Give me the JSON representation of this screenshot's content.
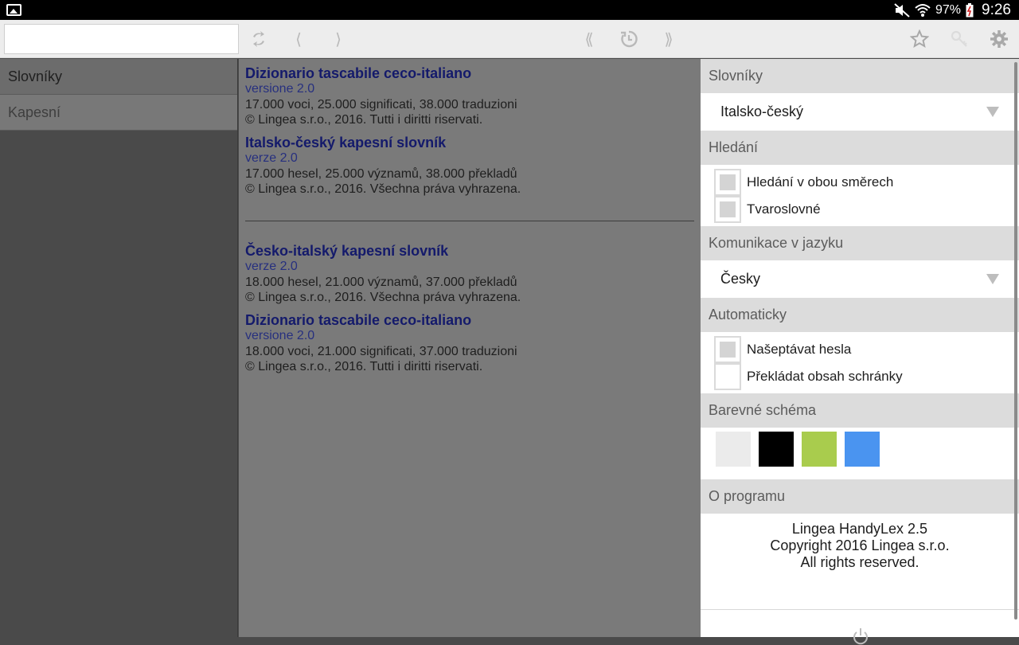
{
  "status": {
    "battery": "97%",
    "time": "9:26"
  },
  "toolbar": {
    "search_value": "",
    "icons": [
      "swap-icon",
      "back-icon",
      "forward-icon",
      "first-icon",
      "history-icon",
      "last-icon",
      "star-icon",
      "key-icon",
      "gear-icon"
    ]
  },
  "sidebar": {
    "items": [
      {
        "label": "Slovníky"
      },
      {
        "label": "Kapesní"
      }
    ]
  },
  "content": {
    "groups": [
      {
        "entries": [
          {
            "title": "Dizionario tascabile ceco-italiano",
            "version": "versione 2.0",
            "stats": "17.000 voci, 25.000 significati, 38.000 traduzioni",
            "copyright": "© Lingea s.r.o., 2016. Tutti i diritti riservati."
          },
          {
            "title": "Italsko-český kapesní slovník",
            "version": "verze 2.0",
            "stats": "17.000 hesel, 25.000 významů, 38.000 překladů",
            "copyright": "© Lingea s.r.o., 2016. Všechna práva vyhrazena."
          }
        ]
      },
      {
        "entries": [
          {
            "title": "Česko-italský kapesní slovník",
            "version": "verze 2.0",
            "stats": "18.000 hesel, 21.000 významů, 37.000 překladů",
            "copyright": "© Lingea s.r.o., 2016. Všechna práva vyhrazena."
          },
          {
            "title": "Dizionario tascabile ceco-italiano",
            "version": "versione 2.0",
            "stats": "18.000 voci, 21.000 significati, 37.000 traduzioni",
            "copyright": "© Lingea s.r.o., 2016. Tutti i diritti riservati."
          }
        ]
      }
    ]
  },
  "panel": {
    "dictionaries": {
      "heading": "Slovníky",
      "selected": "Italsko-český"
    },
    "search": {
      "heading": "Hledání",
      "options": [
        {
          "label": "Hledání v obou směrech",
          "checked": false
        },
        {
          "label": "Tvaroslovné",
          "checked": false
        }
      ]
    },
    "language": {
      "heading": "Komunikace v jazyku",
      "selected": "Česky"
    },
    "automatic": {
      "heading": "Automaticky",
      "options": [
        {
          "label": "Našeptávat hesla",
          "checked": false
        },
        {
          "label": "Překládat obsah schránky",
          "checked": false
        }
      ]
    },
    "colors": {
      "heading": "Barevné schéma",
      "swatches": [
        "#ebebeb",
        "#000000",
        "#a9cc4d",
        "#4a94f0"
      ]
    },
    "about": {
      "heading": "O programu",
      "line1": "Lingea HandyLex 2.5",
      "line2": "Copyright 2016 Lingea s.r.o.",
      "line3": "All rights reserved."
    }
  }
}
